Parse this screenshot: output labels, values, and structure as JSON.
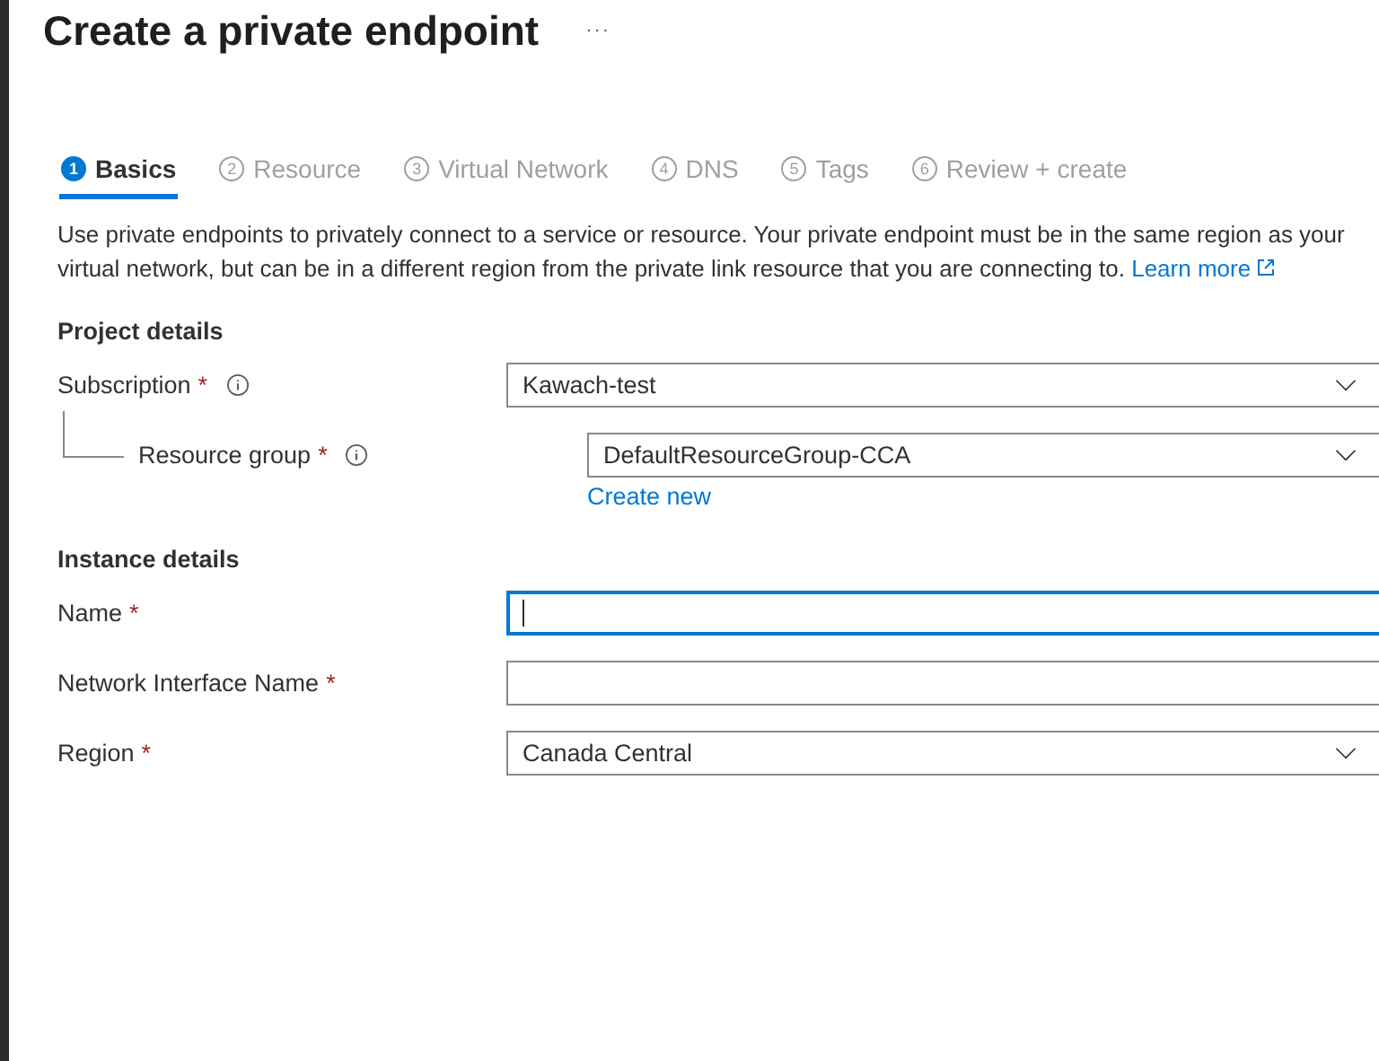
{
  "title": "Create a private endpoint",
  "more": "···",
  "tabs": [
    {
      "number": "1",
      "label": "Basics",
      "selected": true
    },
    {
      "number": "2",
      "label": "Resource",
      "selected": false
    },
    {
      "number": "3",
      "label": "Virtual Network",
      "selected": false
    },
    {
      "number": "4",
      "label": "DNS",
      "selected": false
    },
    {
      "number": "5",
      "label": "Tags",
      "selected": false
    },
    {
      "number": "6",
      "label": "Review + create",
      "selected": false
    }
  ],
  "description": "Use private endpoints to privately connect to a service or resource. Your private endpoint must be in the same region as your virtual network, but can be in a different region from the private link resource that you are connecting to.",
  "learn_more": "Learn more",
  "sections": [
    {
      "heading": "Project details",
      "fields": [
        {
          "label": "Subscription",
          "required": "*",
          "info": true,
          "nested": false,
          "kind": "dropdown",
          "value": "Kawach-test",
          "focused": false
        },
        {
          "label": "Resource group",
          "required": "*",
          "info": true,
          "nested": true,
          "kind": "dropdown",
          "value": "DefaultResourceGroup-CCA",
          "focused": false,
          "link": "Create new"
        }
      ]
    },
    {
      "heading": "Instance details",
      "fields": [
        {
          "label": "Name",
          "required": "*",
          "info": false,
          "nested": false,
          "kind": "text",
          "focused": true
        },
        {
          "label": "Network Interface Name",
          "required": "*",
          "info": false,
          "nested": false,
          "kind": "text",
          "focused": false
        },
        {
          "label": "Region",
          "required": "*",
          "info": false,
          "nested": false,
          "kind": "dropdown",
          "value": "Canada Central",
          "focused": false
        }
      ]
    }
  ]
}
